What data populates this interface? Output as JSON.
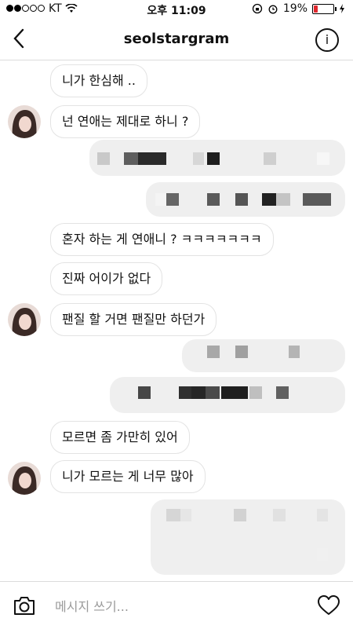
{
  "status_bar": {
    "carrier": "KT",
    "time": "오후 11:09",
    "battery_percent": "19%",
    "battery_level": 0.19,
    "battery_color": "#e0282e"
  },
  "header": {
    "title": "seolstargram",
    "back_icon": "chevron-left-icon",
    "info_icon": "info-icon"
  },
  "messages": [
    {
      "text": "니가 한심해 .."
    },
    {
      "text": "넌 연애는 제대로 하니 ?"
    },
    {
      "text": "혼자 하는 게 연애니 ? ㅋㅋㅋㅋㅋㅋㅋ"
    },
    {
      "text": "진짜 어이가 없다"
    },
    {
      "text": "팬질 할 거면 팬질만 하던가"
    },
    {
      "text": "모르면 좀 가만히 있어"
    },
    {
      "text": "니가 모르는 게 너무 많아"
    }
  ],
  "composer": {
    "placeholder": "메시지 쓰기...",
    "camera_icon": "camera-icon",
    "heart_icon": "heart-icon"
  }
}
